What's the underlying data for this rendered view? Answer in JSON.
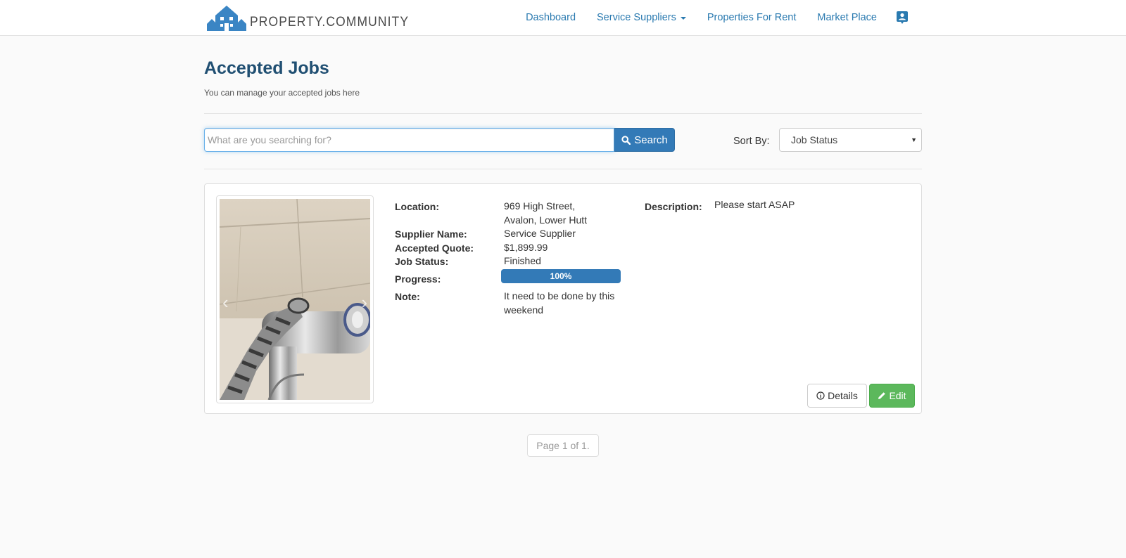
{
  "brand": {
    "name": "PROPERTY.COMMUNITY",
    "logo_icon": "house-logo-icon",
    "color": "#3a85c4"
  },
  "nav": {
    "items": [
      {
        "label": "Dashboard"
      },
      {
        "label": "Service Suppliers"
      },
      {
        "label": "Properties For Rent"
      },
      {
        "label": "Market Place"
      }
    ],
    "profile_icon": "user-card-icon"
  },
  "page": {
    "title": "Accepted Jobs",
    "subtitle": "You can manage your accepted jobs here"
  },
  "search": {
    "placeholder": "What are you searching for?",
    "value": "",
    "button_label": "Search",
    "button_icon": "search-icon"
  },
  "sort": {
    "label": "Sort By:",
    "selected": "Job Status"
  },
  "job": {
    "fields": {
      "location_label": "Location:",
      "location_line1": "969 High Street,",
      "location_line2": "Avalon, Lower Hutt",
      "supplier_label": "Supplier Name:",
      "supplier_value": "Service Supplier",
      "quote_label": "Accepted Quote:",
      "quote_value": "$1,899.99",
      "status_label": "Job Status:",
      "status_value": "Finished",
      "progress_label": "Progress:",
      "progress_percent": 100,
      "progress_text": "100%",
      "note_label": "Note:",
      "note_line1": "It need to be done by this",
      "note_line2": "weekend",
      "description_label": "Description:",
      "description_value": "Please start ASAP"
    },
    "details_label": "Details",
    "details_icon": "info-circle-icon",
    "edit_label": "Edit",
    "edit_icon": "pencil-icon"
  },
  "pagination": {
    "text": "Page 1 of 1."
  },
  "colors": {
    "primary": "#337ab7",
    "success": "#5cb85c",
    "heading": "#204f72",
    "link": "#2a7ab0"
  }
}
